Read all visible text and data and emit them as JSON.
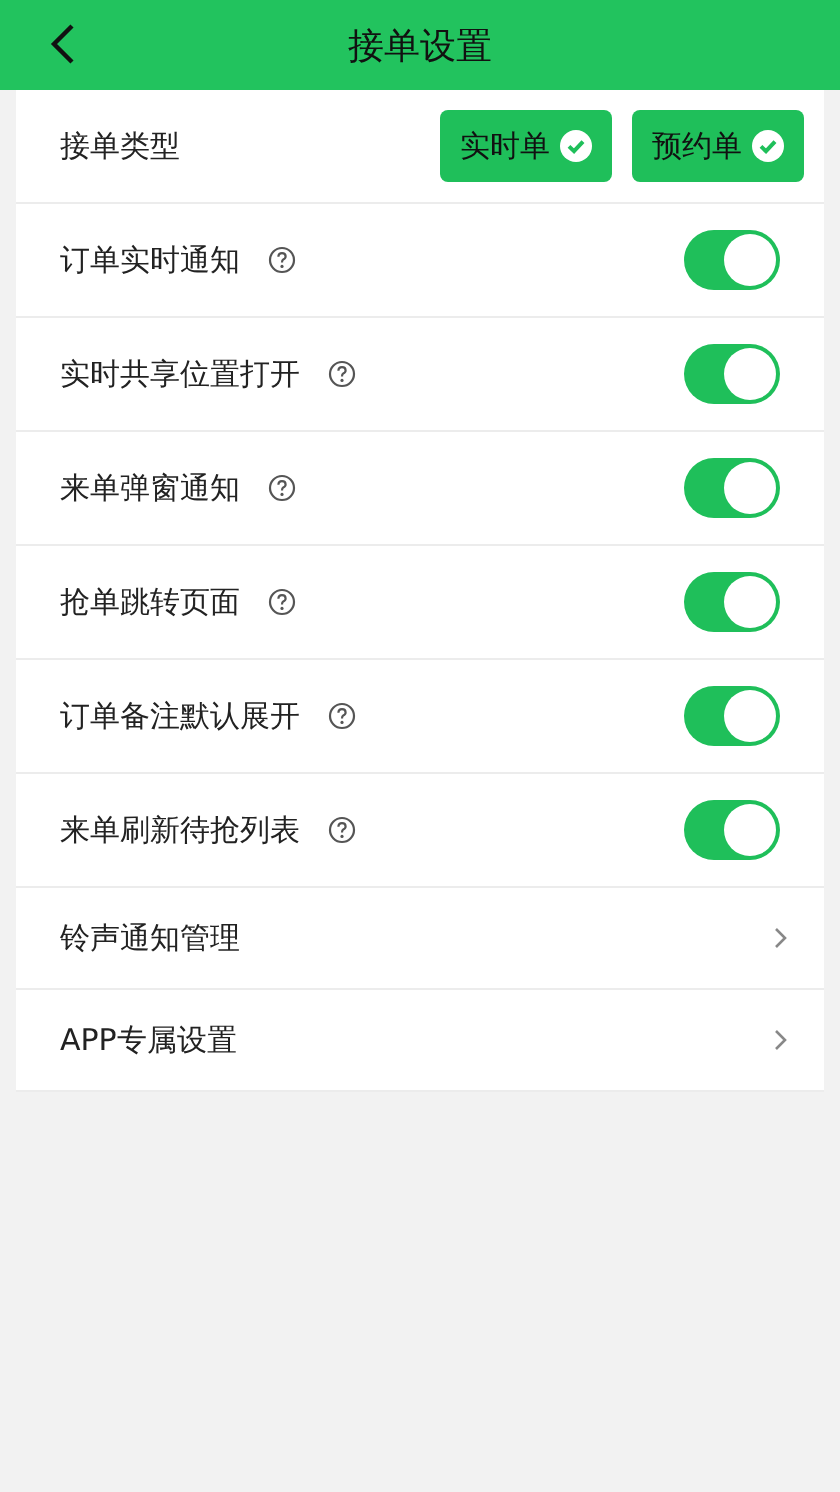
{
  "header": {
    "title": "接单设置"
  },
  "order_type": {
    "label": "接单类型",
    "options": [
      {
        "label": "实时单",
        "selected": true
      },
      {
        "label": "预约单",
        "selected": true
      }
    ]
  },
  "settings": [
    {
      "label": "订单实时通知",
      "kind": "toggle",
      "on": true
    },
    {
      "label": "实时共享位置打开",
      "kind": "toggle",
      "on": true
    },
    {
      "label": "来单弹窗通知",
      "kind": "toggle",
      "on": true
    },
    {
      "label": "抢单跳转页面",
      "kind": "toggle",
      "on": true
    },
    {
      "label": "订单备注默认展开",
      "kind": "toggle",
      "on": true
    },
    {
      "label": "来单刷新待抢列表",
      "kind": "toggle",
      "on": true
    },
    {
      "label": "铃声通知管理",
      "kind": "link"
    },
    {
      "label": "APP专属设置",
      "kind": "link"
    }
  ]
}
